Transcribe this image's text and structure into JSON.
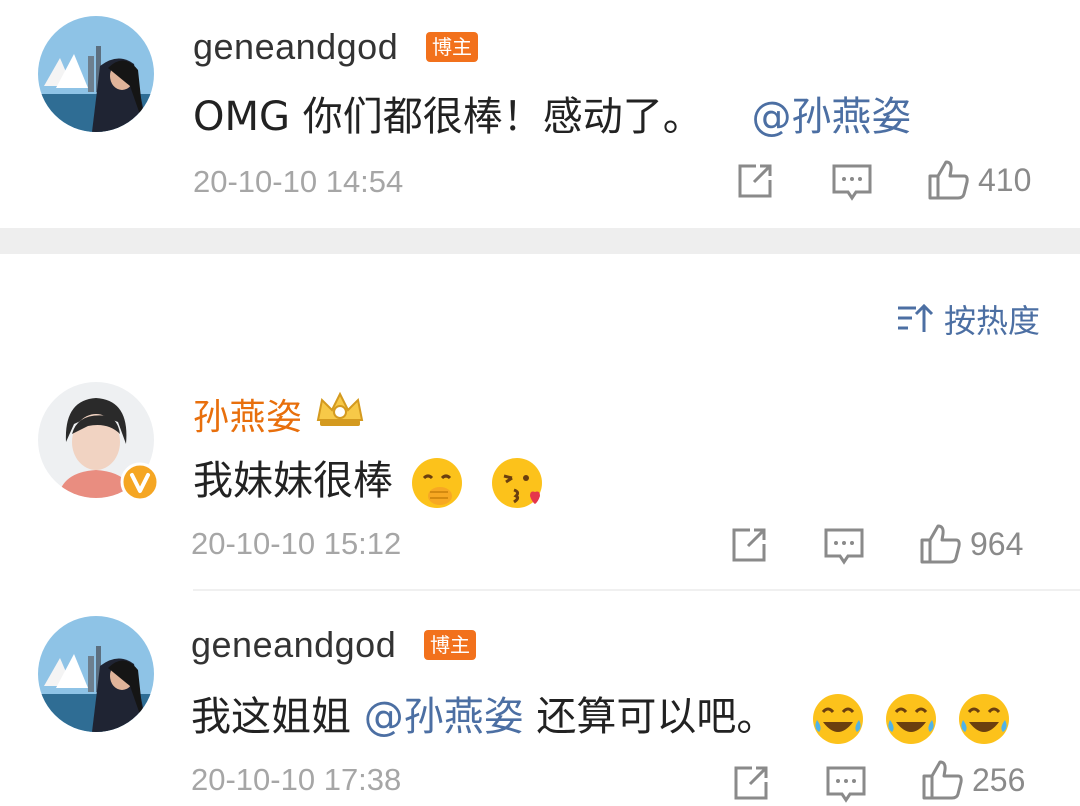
{
  "comments": [
    {
      "username": "geneandgod",
      "badge": "博主",
      "text": "OMG 你们都很棒！感动了。",
      "mention": "@孙燕姿",
      "time": "20-10-10 14:54",
      "likes": "410"
    },
    {
      "username": "孙燕姿",
      "text": "我妹妹很棒",
      "time": "20-10-10 15:12",
      "likes": "964"
    },
    {
      "username": "geneandgod",
      "badge": "博主",
      "text_before": "我这姐姐 ",
      "mention": "@孙燕姿",
      "text_after": " 还算可以吧。",
      "time": "20-10-10 17:38",
      "likes": "256"
    }
  ],
  "sort": {
    "label": "按热度"
  },
  "icons": [
    "share-icon",
    "comment-icon",
    "like-icon",
    "sort-icon",
    "crown-badge-icon",
    "verified-v-icon"
  ],
  "colors": {
    "badge": "#f2711c",
    "mention": "#4c6fa3",
    "vip_name": "#e86f0c",
    "timestamp": "#a6a6a6"
  }
}
